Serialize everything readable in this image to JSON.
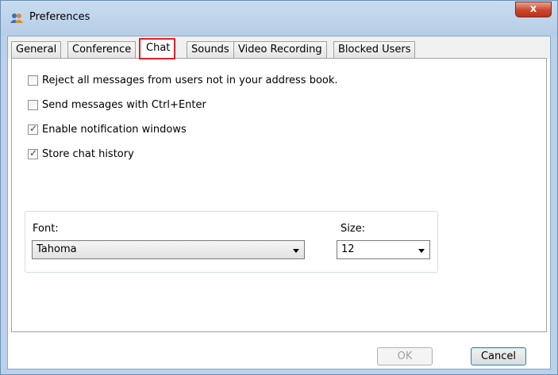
{
  "window": {
    "title": "Preferences",
    "close_glyph": "x",
    "icon": "users-icon"
  },
  "tabs": [
    {
      "label": "General",
      "active": false
    },
    {
      "label": "Conference",
      "active": false
    },
    {
      "label": "Chat",
      "active": true
    },
    {
      "label": "Sounds",
      "active": false
    },
    {
      "label": "Video Recording",
      "active": false
    },
    {
      "label": "Blocked Users",
      "active": false
    }
  ],
  "options": [
    {
      "label": "Reject all messages from users not in your address book.",
      "checked": false
    },
    {
      "label": "Send messages with Ctrl+Enter",
      "checked": false
    },
    {
      "label": "Enable notification windows",
      "checked": true
    },
    {
      "label": "Store chat history",
      "checked": true
    }
  ],
  "font": {
    "label": "Font:",
    "value": "Tahoma"
  },
  "size": {
    "label": "Size:",
    "value": "12"
  },
  "buttons": {
    "ok": "OK",
    "cancel": "Cancel"
  },
  "colors": {
    "highlight": "#e0202a",
    "title_bar": "#b9d1ea",
    "close": "#c9462c"
  }
}
